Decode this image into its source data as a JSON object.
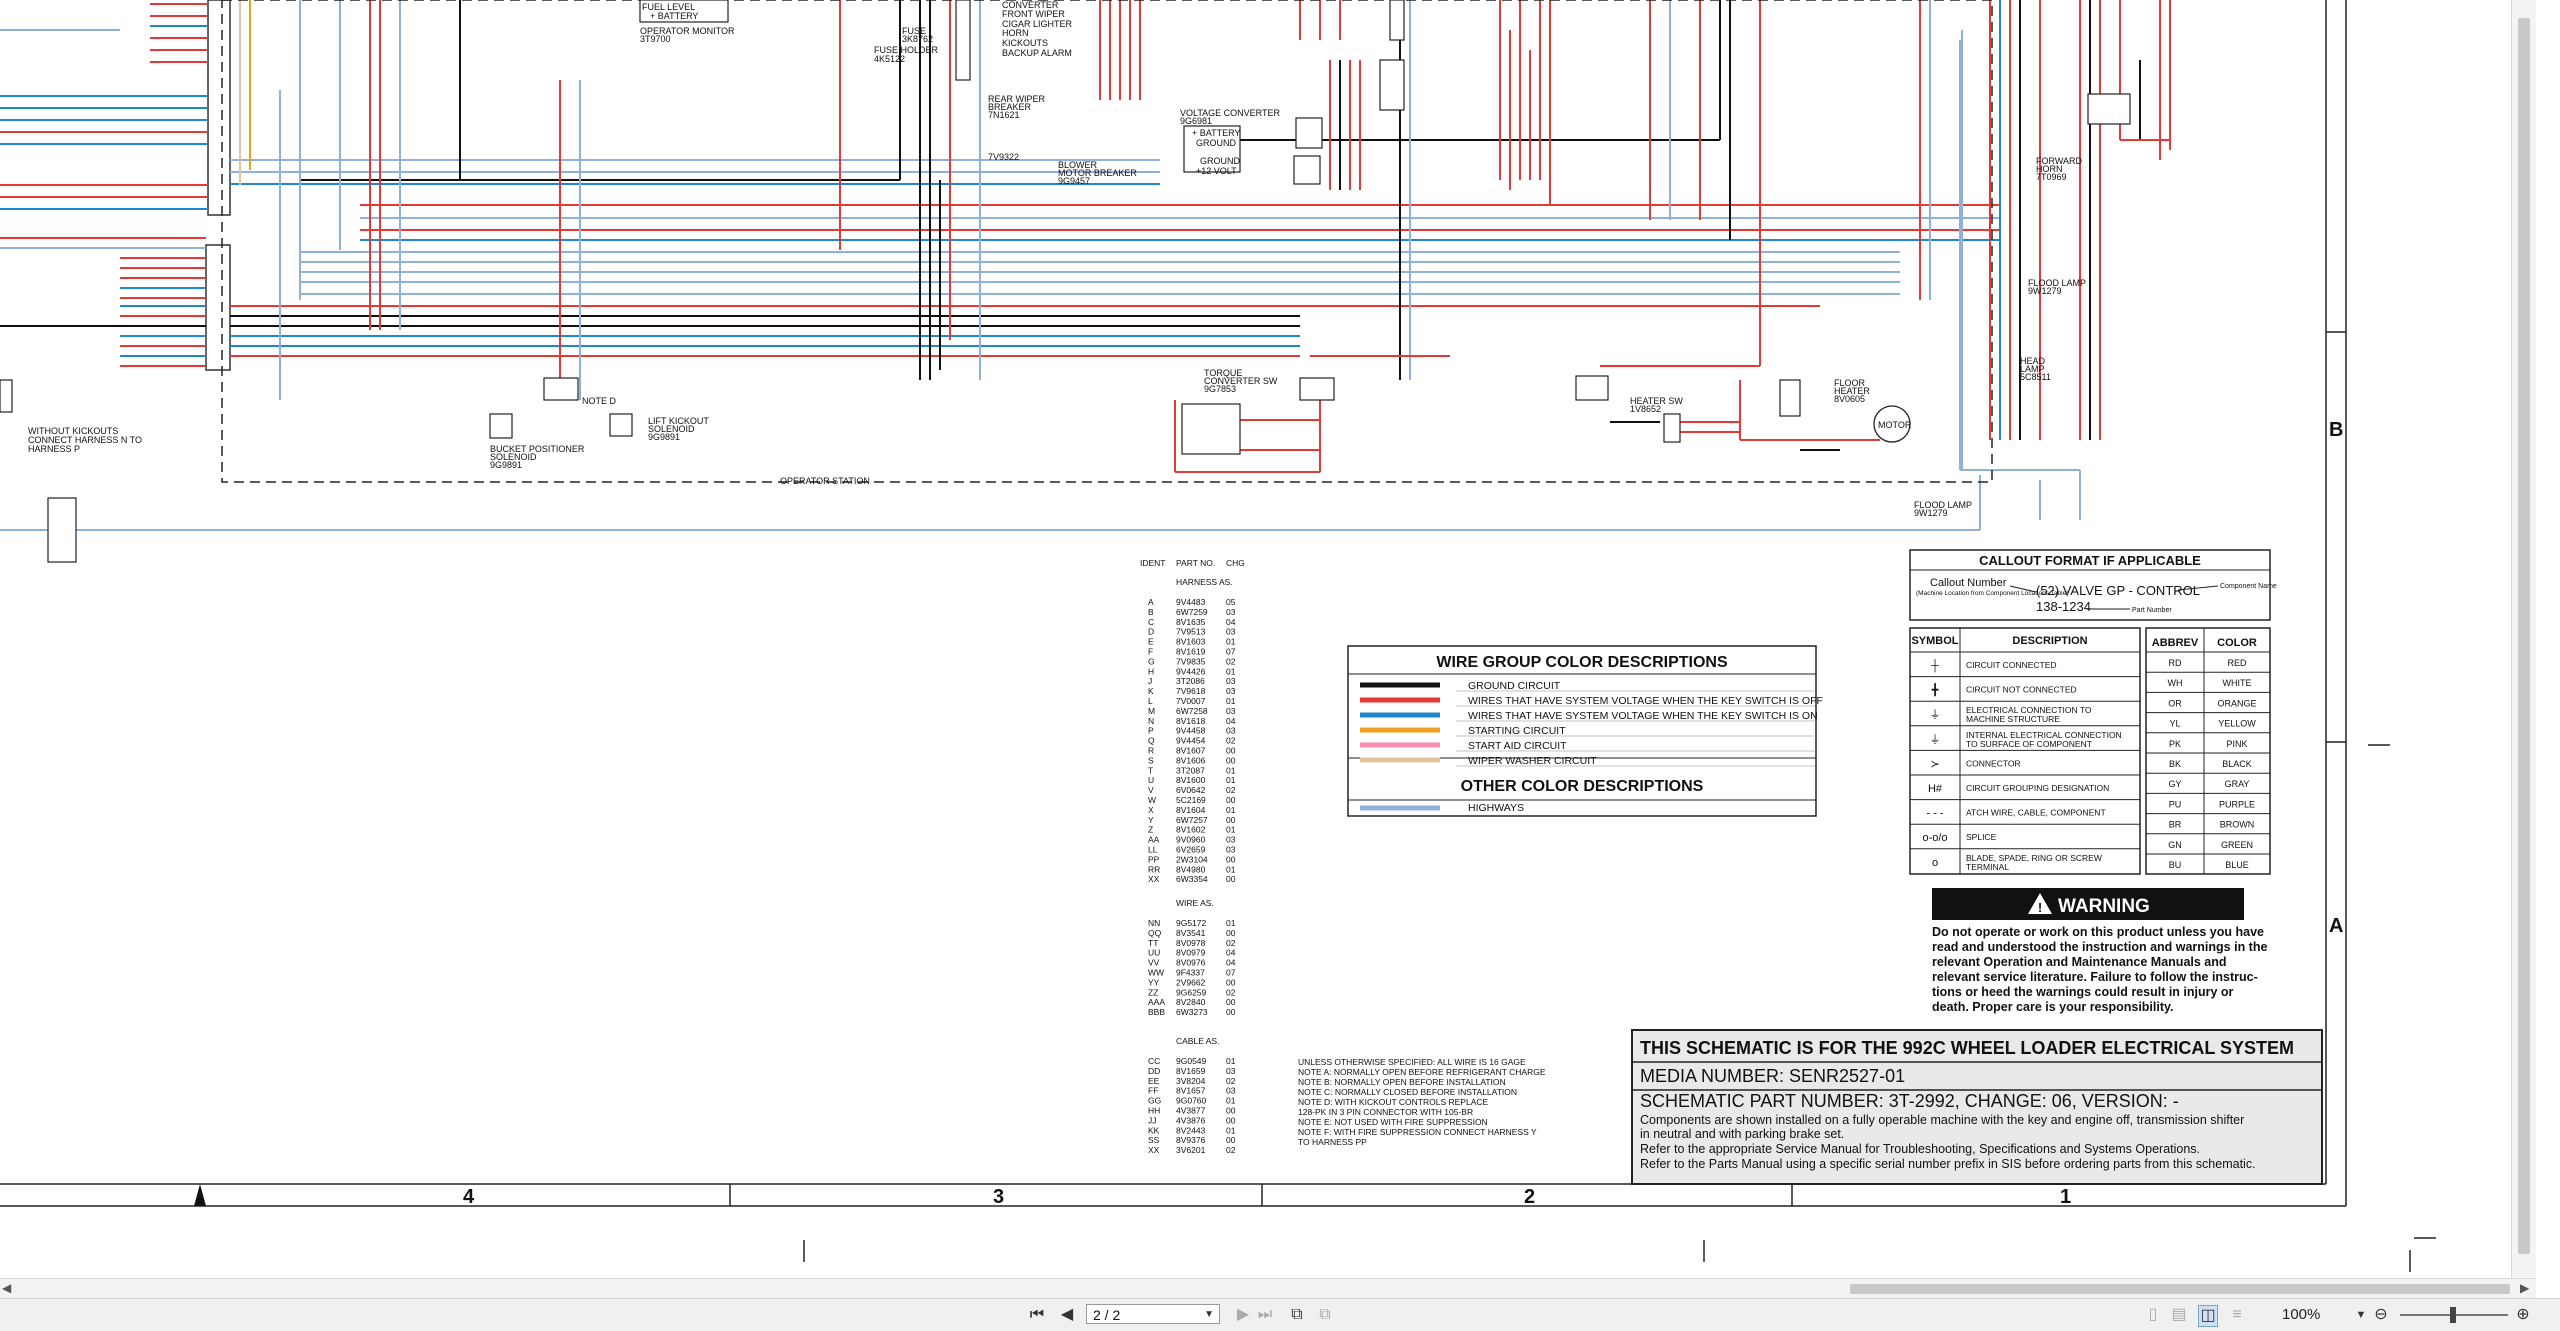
{
  "schematic": {
    "title_block": {
      "title": "THIS SCHEMATIC IS FOR THE 992C WHEEL LOADER ELECTRICAL SYSTEM",
      "media": "MEDIA NUMBER: SENR2527-01",
      "part": "SCHEMATIC PART NUMBER: 3T-2992, CHANGE: 06, VERSION: -",
      "notes": [
        "Components are shown installed on a fully operable machine with the key and engine off, transmission shifter",
        "in neutral and with parking brake set.",
        "Refer to the appropriate Service Manual for Troubleshooting, Specifications and Systems Operations.",
        "Refer to the Parts Manual using a specific serial number prefix in SIS before ordering parts from this schematic."
      ]
    },
    "wire_group": {
      "title": "WIRE GROUP COLOR DESCRIPTIONS",
      "items": [
        {
          "color": "#111111",
          "label": "GROUND CIRCUIT"
        },
        {
          "color": "#e53935",
          "label": "WIRES THAT HAVE SYSTEM VOLTAGE WHEN THE KEY SWITCH IS OFF"
        },
        {
          "color": "#1e88c9",
          "label": "WIRES THAT HAVE SYSTEM VOLTAGE WHEN THE KEY SWITCH IS ON"
        },
        {
          "color": "#f0a020",
          "label": "STARTING CIRCUIT"
        },
        {
          "color": "#f48fb1",
          "label": "START AID CIRCUIT"
        },
        {
          "color": "#e3c3a3",
          "label": "WIPER WASHER CIRCUIT"
        }
      ],
      "other_title": "OTHER COLOR DESCRIPTIONS",
      "other_items": [
        {
          "color": "#8fb0d8",
          "label": "HIGHWAYS"
        }
      ]
    },
    "callout": {
      "title": "CALLOUT FORMAT IF APPLICABLE",
      "callout_number": "Callout Number",
      "callout_sub": "(Machine Location from Component Locations Table)",
      "example": "(52) VALVE GP - CONTROL",
      "part": "138-1234",
      "component_name": "Component Name",
      "part_number": "Part Number"
    },
    "symbols": {
      "headers": [
        "SYMBOL",
        "DESCRIPTION"
      ],
      "rows": [
        {
          "sym": "┼",
          "desc": "CIRCUIT CONNECTED"
        },
        {
          "sym": "╋",
          "desc": "CIRCUIT NOT CONNECTED"
        },
        {
          "sym": "⏚",
          "desc": "ELECTRICAL CONNECTION TO MACHINE STRUCTURE"
        },
        {
          "sym": "⏚",
          "desc": "INTERNAL ELECTRICAL CONNECTION TO SURFACE OF COMPONENT"
        },
        {
          "sym": "≻",
          "desc": "CONNECTOR"
        },
        {
          "sym": "H#",
          "desc": "CIRCUIT GROUPING DESIGNATION"
        },
        {
          "sym": "- - -",
          "desc": "ATCH WIRE, CABLE, COMPONENT"
        },
        {
          "sym": "o-o/o",
          "desc": "SPLICE"
        },
        {
          "sym": "o",
          "desc": "BLADE, SPADE, RING OR SCREW TERMINAL"
        }
      ]
    },
    "colors_table": {
      "headers": [
        "ABBREV",
        "COLOR"
      ],
      "rows": [
        [
          "RD",
          "RED"
        ],
        [
          "WH",
          "WHITE"
        ],
        [
          "OR",
          "ORANGE"
        ],
        [
          "YL",
          "YELLOW"
        ],
        [
          "PK",
          "PINK"
        ],
        [
          "BK",
          "BLACK"
        ],
        [
          "GY",
          "GRAY"
        ],
        [
          "PU",
          "PURPLE"
        ],
        [
          "BR",
          "BROWN"
        ],
        [
          "GN",
          "GREEN"
        ],
        [
          "BU",
          "BLUE"
        ]
      ]
    },
    "warning": {
      "title": "WARNING",
      "lines": [
        "Do not operate or work on this product unless you have",
        "read and understood the instruction and warnings in the",
        "relevant Operation and Maintenance Manuals and",
        "relevant service literature. Failure to follow the instruc-",
        "tions or heed the warnings could result in injury or",
        "death. Proper care is your responsibility."
      ]
    },
    "ident": {
      "headers": [
        "IDENT",
        "PART NO.",
        "CHG"
      ],
      "harness_title": "HARNESS AS.",
      "harness_rows": [
        [
          "A",
          "9V4483",
          "05"
        ],
        [
          "B",
          "6W7259",
          "03"
        ],
        [
          "C",
          "8V1635",
          "04"
        ],
        [
          "D",
          "7V9513",
          "03"
        ],
        [
          "E",
          "8V1603",
          "01"
        ],
        [
          "F",
          "8V1619",
          "07"
        ],
        [
          "G",
          "7V9835",
          "02"
        ],
        [
          "H",
          "9V4426",
          "01"
        ],
        [
          "J",
          "3T2086",
          "03"
        ],
        [
          "K",
          "7V9618",
          "03"
        ],
        [
          "L",
          "7V0007",
          "01"
        ],
        [
          "M",
          "6W7258",
          "03"
        ],
        [
          "N",
          "8V1618",
          "04"
        ],
        [
          "P",
          "9V4458",
          "03"
        ],
        [
          "Q",
          "9V4454",
          "02"
        ],
        [
          "R",
          "8V1607",
          "00"
        ],
        [
          "S",
          "8V1606",
          "00"
        ],
        [
          "T",
          "3T2087",
          "01"
        ],
        [
          "U",
          "8V1600",
          "01"
        ],
        [
          "V",
          "6V0642",
          "02"
        ],
        [
          "W",
          "5C2169",
          "00"
        ],
        [
          "X",
          "8V1604",
          "01"
        ],
        [
          "Y",
          "6W7257",
          "00"
        ],
        [
          "Z",
          "8V1602",
          "01"
        ],
        [
          "AA",
          "9V0960",
          "03"
        ],
        [
          "LL",
          "6V2659",
          "03"
        ],
        [
          "PP",
          "2W3104",
          "00"
        ],
        [
          "RR",
          "8V4980",
          "01"
        ],
        [
          "XX",
          "6W3354",
          "00"
        ]
      ],
      "wire_title": "WIRE AS.",
      "wire_rows": [
        [
          "NN",
          "9G5172",
          "01"
        ],
        [
          "QQ",
          "8V3541",
          "00"
        ],
        [
          "TT",
          "8V0978",
          "02"
        ],
        [
          "UU",
          "8V0979",
          "04"
        ],
        [
          "VV",
          "8V0976",
          "04"
        ],
        [
          "WW",
          "9F4337",
          "07"
        ],
        [
          "YY",
          "2V9662",
          "00"
        ],
        [
          "ZZ",
          "9G6259",
          "02"
        ],
        [
          "AAA",
          "8V2840",
          "00"
        ],
        [
          "BBB",
          "6W3273",
          "00"
        ]
      ],
      "cable_title": "CABLE AS.",
      "cable_rows": [
        [
          "CC",
          "9G0549",
          "01"
        ],
        [
          "DD",
          "8V1659",
          "03"
        ],
        [
          "EE",
          "3V8204",
          "02"
        ],
        [
          "FF",
          "8V1657",
          "03"
        ],
        [
          "GG",
          "9G0760",
          "01"
        ],
        [
          "HH",
          "4V3877",
          "00"
        ],
        [
          "JJ",
          "4V3876",
          "00"
        ],
        [
          "KK",
          "8V2443",
          "01"
        ],
        [
          "SS",
          "8V9376",
          "00"
        ],
        [
          "XX",
          "3V6201",
          "02"
        ]
      ]
    },
    "wire_notes": [
      "UNLESS OTHERWISE SPECIFIED: ALL WIRE IS 16 GAGE",
      "NOTE A: NORMALLY OPEN BEFORE REFRIGERANT CHARGE",
      "NOTE B: NORMALLY OPEN BEFORE INSTALLATION",
      "NOTE C: NORMALLY CLOSED BEFORE INSTALLATION",
      "NOTE D: WITH KICKOUT CONTROLS REPLACE",
      "    128-PK IN 3 PIN CONNECTOR WITH 105-BR",
      "NOTE E: NOT USED WITH FIRE SUPPRESSION",
      "NOTE F: WITH FIRE SUPPRESSION CONNECT HARNESS Y",
      "    TO HARNESS PP"
    ],
    "zones_bottom": [
      "4",
      "3",
      "2",
      "1"
    ],
    "zones_side": [
      "B",
      "A"
    ],
    "labels": {
      "operator_station": "OPERATOR STATION",
      "operator_monitor": "OPERATOR MONITOR",
      "operator_monitor_pn": "3T9700",
      "fuel_level": "FUEL LEVEL",
      "battery": "+ BATTERY",
      "fuse": "FUSE",
      "fuse_pn": "3K8762",
      "fuse_holder": "FUSE HOLDER",
      "fuse_holder_pn": "4K5122",
      "rear_wiper": "REAR WIPER",
      "breaker": "BREAKER",
      "breaker_pn": "7N1621",
      "blower": "BLOWER",
      "motor_breaker": "MOTOR BREAKER",
      "motor_breaker_pn": "9G9457",
      "tv": "7V9322",
      "voltage_converter": "VOLTAGE CONVERTER",
      "voltage_converter_pn": "9G6981",
      "vc_battery": "+ BATTERY",
      "vc_ground": "GROUND",
      "vc_ground2": "GROUND",
      "vc_volt": "+12 VOLT",
      "forward_horn": "FORWARD",
      "horn": "HORN",
      "horn_pn": "7T0969",
      "flood_lamp": "FLOOD LAMP",
      "flood_lamp_pn": "9W1279",
      "head_lamp": "HEAD",
      "lamp": "LAMP",
      "head_lamp_pn": "5C8511",
      "torque_converter": "TORQUE",
      "converter_sw": "CONVERTER SW",
      "converter_sw_pn": "9G7853",
      "heater_sw": "HEATER SW",
      "heater_sw_pn": "1V8652",
      "floor": "FLOOR",
      "heater": "HEATER",
      "heater_pn": "8V0605",
      "motor": "MOTOR",
      "without_kickouts": "WITHOUT KICKOUTS",
      "connect_harness": "CONNECT HARNESS N TO",
      "harness_p": "HARNESS P",
      "bucket_positioner": "BUCKET POSITIONER",
      "solenoid": "SOLENOID",
      "bucket_pn": "9G9891",
      "lift_kickout": "LIFT KICKOUT",
      "lift_solenoid": "SOLENOID",
      "lift_pn": "9G9891",
      "note_d": "NOTE D",
      "fuse_list": [
        "CONVERTER",
        "FRONT WIPER",
        "CIGAR LIGHTER",
        "HORN",
        "KICKOUTS",
        "BACKUP ALARM"
      ]
    }
  },
  "viewer": {
    "page_indicator": "2 / 2",
    "zoom": "100%"
  }
}
